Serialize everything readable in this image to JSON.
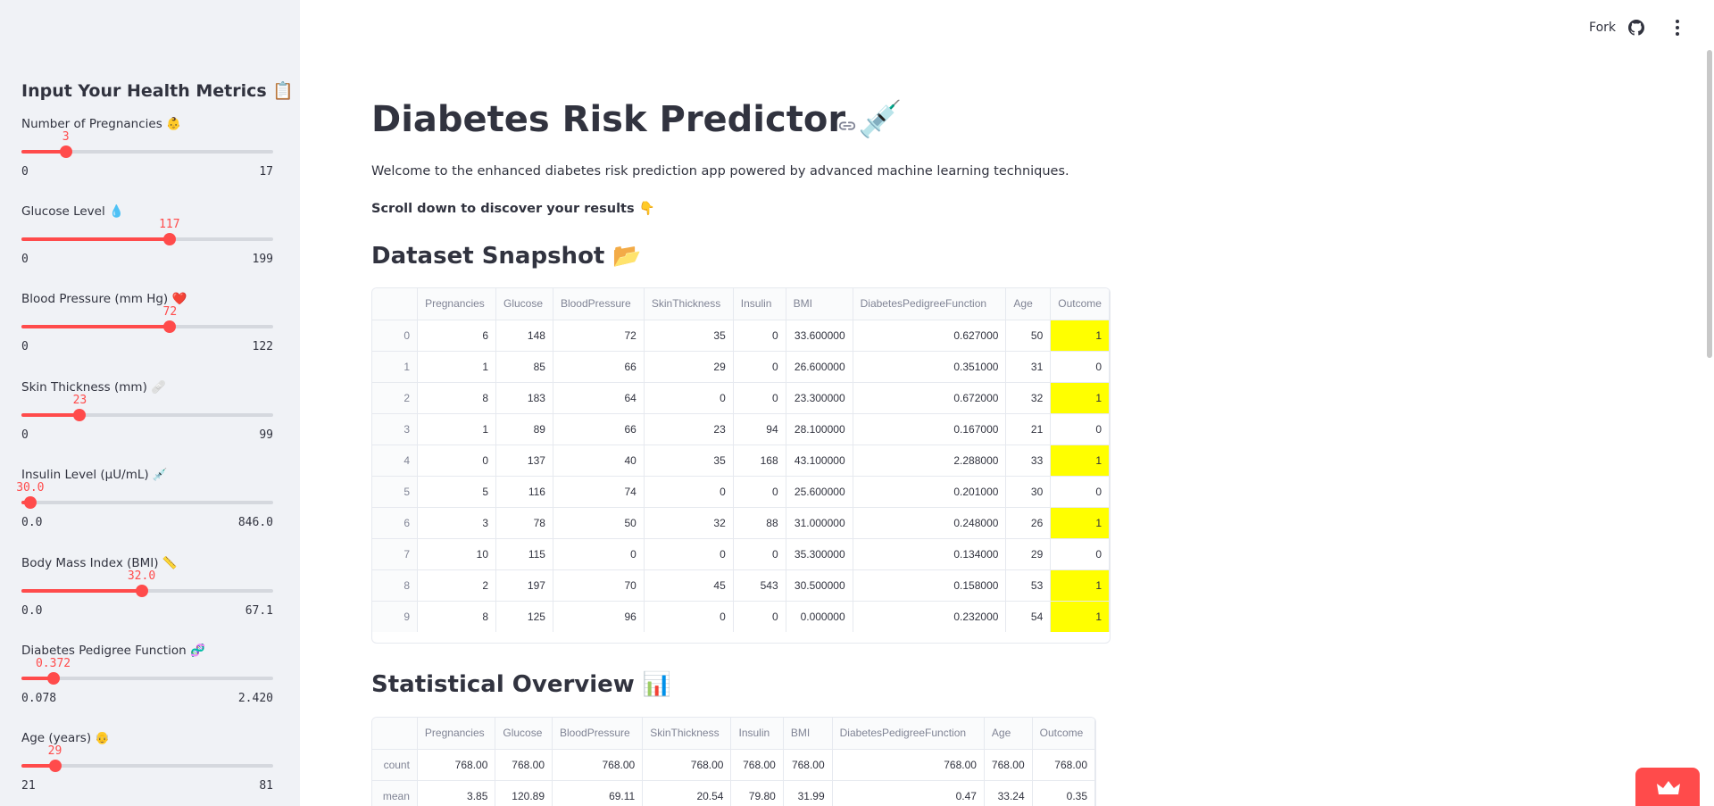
{
  "sidebar": {
    "title": "Input Your Health Metrics 📋",
    "sliders": [
      {
        "label": "Number of Pregnancies 👶",
        "value": "3",
        "min": "0",
        "max": "17",
        "fraction": 0.176
      },
      {
        "label": "Glucose Level 💧",
        "value": "117",
        "min": "0",
        "max": "199",
        "fraction": 0.588
      },
      {
        "label": "Blood Pressure (mm Hg) ❤️",
        "value": "72",
        "min": "0",
        "max": "122",
        "fraction": 0.59
      },
      {
        "label": "Skin Thickness (mm) 🩹",
        "value": "23",
        "min": "0",
        "max": "99",
        "fraction": 0.232
      },
      {
        "label": "Insulin Level (µU/mL) 💉",
        "value": "30.0",
        "min": "0.0",
        "max": "846.0",
        "fraction": 0.035
      },
      {
        "label": "Body Mass Index (BMI) 📏",
        "value": "32.0",
        "min": "0.0",
        "max": "67.1",
        "fraction": 0.477
      },
      {
        "label": "Diabetes Pedigree Function 🧬",
        "value": "0.372",
        "min": "0.078",
        "max": "2.420",
        "fraction": 0.126
      },
      {
        "label": "Age (years) 👴",
        "value": "29",
        "min": "21",
        "max": "81",
        "fraction": 0.133
      }
    ]
  },
  "header": {
    "fork_label": "Fork",
    "github_icon": "github-icon",
    "menu_icon": "kebab-menu-icon"
  },
  "main": {
    "title": "Diabetes Risk Predictor 💉",
    "welcome": "Welcome to the enhanced diabetes risk prediction app powered by advanced machine learning techniques.",
    "scroll_hint": "Scroll down to discover your results 👇",
    "dataset_heading": "Dataset Snapshot 📂",
    "stats_heading": "Statistical Overview 📊"
  },
  "dataset": {
    "columns": [
      "",
      "Pregnancies",
      "Glucose",
      "BloodPressure",
      "SkinThickness",
      "Insulin",
      "BMI",
      "DiabetesPedigreeFunction",
      "Age",
      "Outcome"
    ],
    "rows": [
      [
        "0",
        "6",
        "148",
        "72",
        "35",
        "0",
        "33.600000",
        "0.627000",
        "50",
        "1"
      ],
      [
        "1",
        "1",
        "85",
        "66",
        "29",
        "0",
        "26.600000",
        "0.351000",
        "31",
        "0"
      ],
      [
        "2",
        "8",
        "183",
        "64",
        "0",
        "0",
        "23.300000",
        "0.672000",
        "32",
        "1"
      ],
      [
        "3",
        "1",
        "89",
        "66",
        "23",
        "94",
        "28.100000",
        "0.167000",
        "21",
        "0"
      ],
      [
        "4",
        "0",
        "137",
        "40",
        "35",
        "168",
        "43.100000",
        "2.288000",
        "33",
        "1"
      ],
      [
        "5",
        "5",
        "116",
        "74",
        "0",
        "0",
        "25.600000",
        "0.201000",
        "30",
        "0"
      ],
      [
        "6",
        "3",
        "78",
        "50",
        "32",
        "88",
        "31.000000",
        "0.248000",
        "26",
        "1"
      ],
      [
        "7",
        "10",
        "115",
        "0",
        "0",
        "0",
        "35.300000",
        "0.134000",
        "29",
        "0"
      ],
      [
        "8",
        "2",
        "197",
        "70",
        "45",
        "543",
        "30.500000",
        "0.158000",
        "53",
        "1"
      ],
      [
        "9",
        "8",
        "125",
        "96",
        "0",
        "0",
        "0.000000",
        "0.232000",
        "54",
        "1"
      ]
    ],
    "highlight_color": "#ffff00"
  },
  "stats": {
    "columns": [
      "",
      "Pregnancies",
      "Glucose",
      "BloodPressure",
      "SkinThickness",
      "Insulin",
      "BMI",
      "DiabetesPedigreeFunction",
      "Age",
      "Outcome"
    ],
    "rows": [
      [
        "count",
        "768.00",
        "768.00",
        "768.00",
        "768.00",
        "768.00",
        "768.00",
        "768.00",
        "768.00",
        "768.00"
      ],
      [
        "mean",
        "3.85",
        "120.89",
        "69.11",
        "20.54",
        "79.80",
        "31.99",
        "0.47",
        "33.24",
        "0.35"
      ]
    ]
  },
  "colors": {
    "accent": "#ff4b4b",
    "sidebar_bg": "#f0f2f6",
    "text": "#31333f"
  }
}
